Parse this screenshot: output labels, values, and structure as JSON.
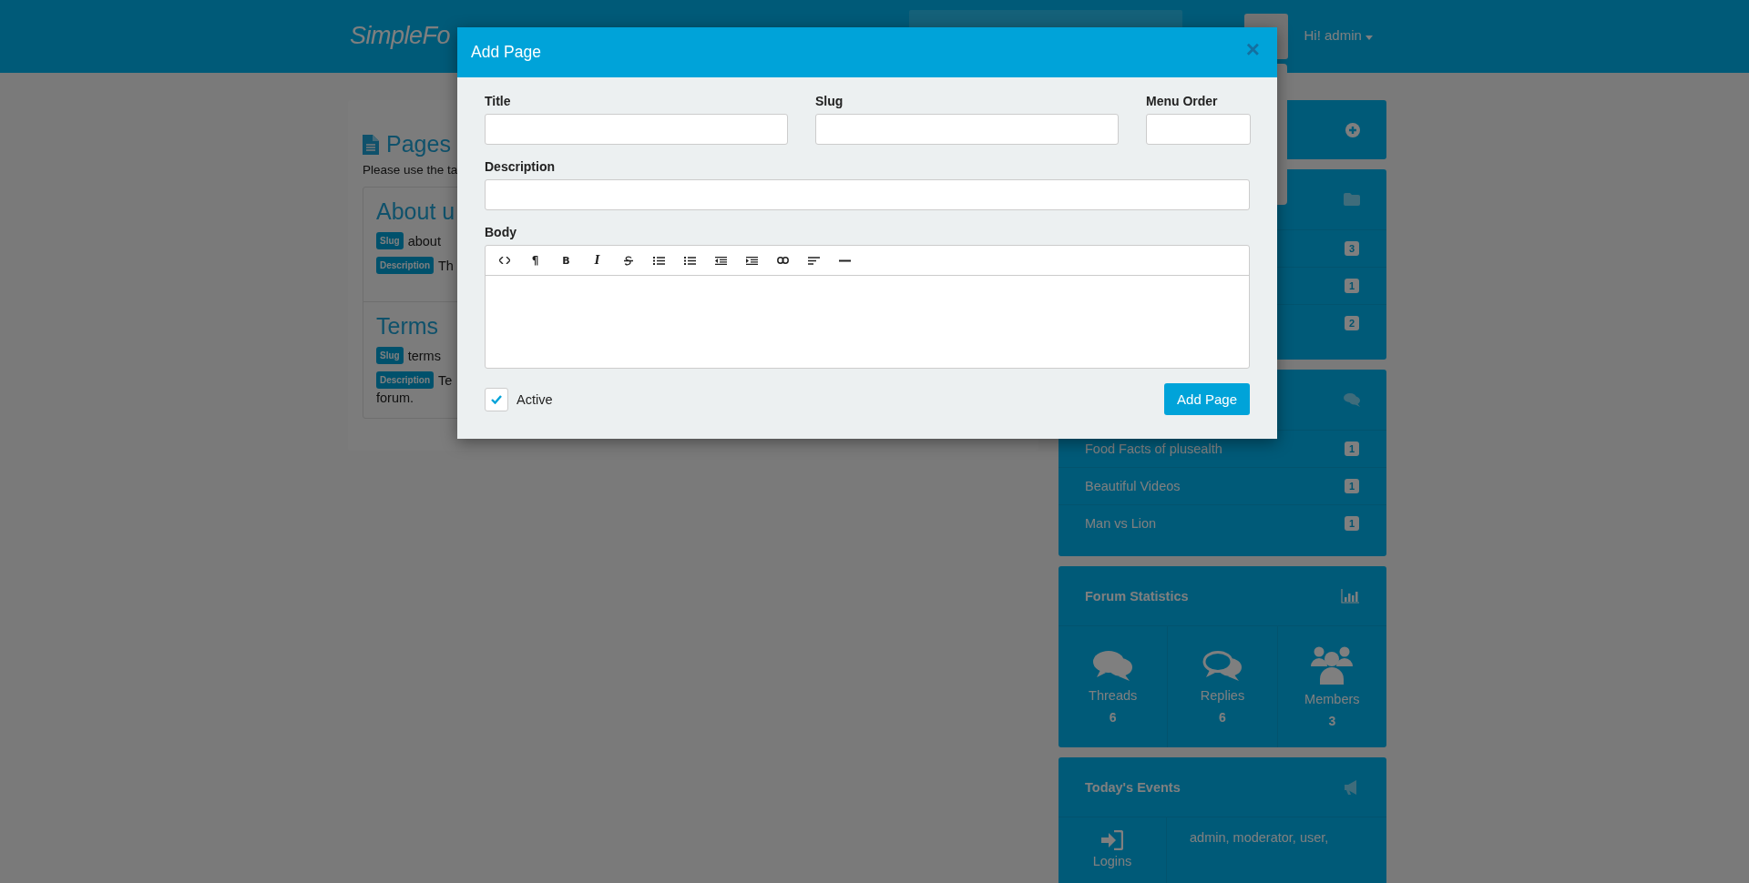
{
  "header": {
    "logo": "Simple**Fo**",
    "user_menu": "Hi! admin"
  },
  "pages": {
    "title": "Pages",
    "intro": "Please use the ta",
    "items": [
      {
        "title": "About u",
        "slug_label": "Slug",
        "slug": "about",
        "description_label": "Description",
        "description": "Th"
      },
      {
        "title": "Terms",
        "slug_label": "Slug",
        "slug": "terms",
        "description_label": "Description",
        "description": "Te",
        "description_more": "forum."
      }
    ]
  },
  "sidebar": {
    "categories": [
      {
        "count": "3"
      },
      {
        "count": "1"
      },
      {
        "count": "2"
      }
    ],
    "threads": [
      {
        "title": "Food Facts of plusealth",
        "count": "1"
      },
      {
        "title": "Beautiful Videos",
        "count": "1"
      },
      {
        "title": "Man vs Lion",
        "count": "1"
      }
    ],
    "statistics": {
      "title": "Forum Statistics",
      "items": [
        {
          "kind": "threads",
          "label": "Threads",
          "value": "6"
        },
        {
          "kind": "replies",
          "label": "Replies",
          "value": "6"
        },
        {
          "kind": "members",
          "label": "Members",
          "value": "3"
        }
      ]
    },
    "events": {
      "title": "Today's Events",
      "label": "Logins",
      "users": "admin, moderator, user,"
    }
  },
  "modal": {
    "title": "Add Page",
    "close": "×",
    "fields": [
      {
        "label": "Title"
      },
      {
        "label": "Slug"
      },
      {
        "label": "Menu Order"
      },
      {
        "label": "Description"
      }
    ],
    "body": {
      "label": "Body",
      "toolbar": [
        {
          "kind": "code"
        },
        {
          "kind": "paragraph",
          "label": "¶"
        },
        {
          "kind": "bold",
          "label": "B"
        },
        {
          "kind": "italic",
          "label": "I"
        },
        {
          "kind": "strike"
        },
        {
          "kind": "ul"
        },
        {
          "kind": "ol"
        },
        {
          "kind": "outdent"
        },
        {
          "kind": "indent"
        },
        {
          "kind": "link"
        },
        {
          "kind": "align"
        },
        {
          "kind": "hr"
        }
      ]
    },
    "active": {
      "label": "Active",
      "checked": true
    },
    "submit": "Add Page"
  }
}
